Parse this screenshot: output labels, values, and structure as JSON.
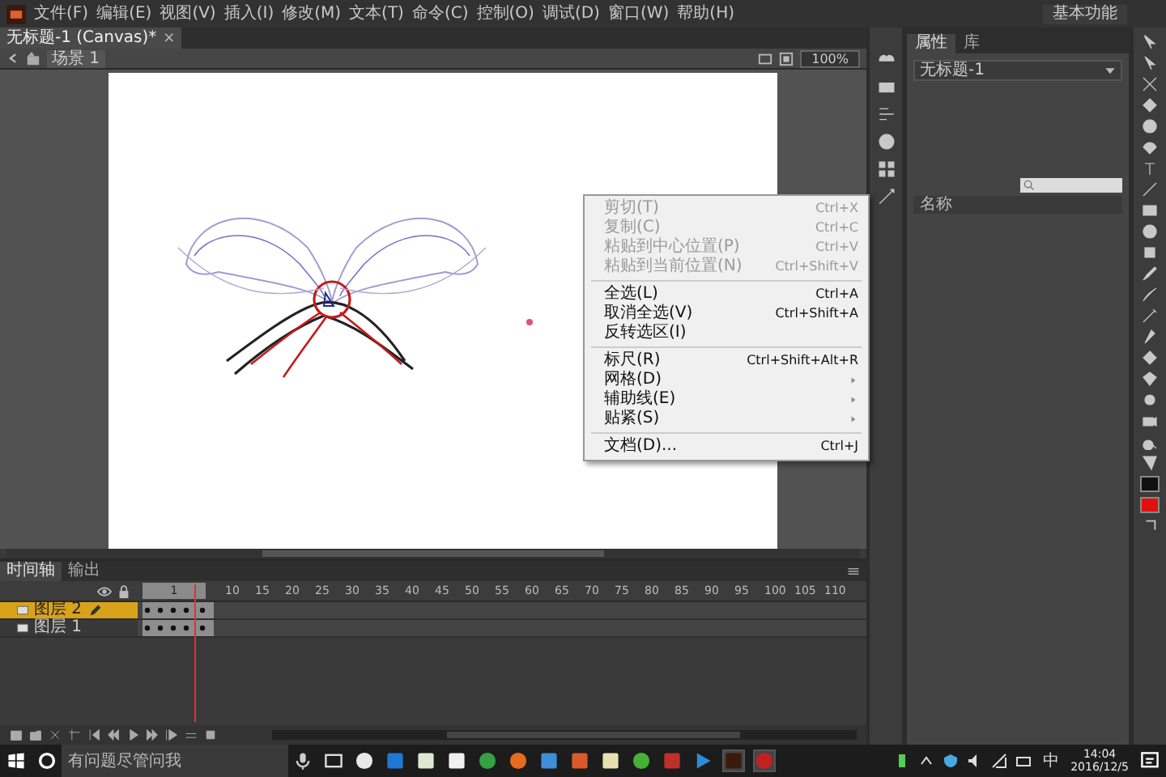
{
  "menu_bar": {
    "items": [
      "文件(F)",
      "编辑(E)",
      "视图(V)",
      "插入(I)",
      "修改(M)",
      "文本(T)",
      "命令(C)",
      "控制(O)",
      "调试(D)",
      "窗口(W)",
      "帮助(H)"
    ],
    "workspace": "基本功能"
  },
  "document_tab": {
    "title": "无标题-1 (Canvas)*",
    "close": "×"
  },
  "edit_bar": {
    "scene": "场景 1",
    "zoom": "100%"
  },
  "context_menu": {
    "groups": [
      [
        {
          "label": "剪切(T)",
          "shortcut": "Ctrl+X",
          "disabled": true,
          "submenu": false
        },
        {
          "label": "复制(C)",
          "shortcut": "Ctrl+C",
          "disabled": true,
          "submenu": false
        },
        {
          "label": "粘贴到中心位置(P)",
          "shortcut": "Ctrl+V",
          "disabled": true,
          "submenu": false
        },
        {
          "label": "粘贴到当前位置(N)",
          "shortcut": "Ctrl+Shift+V",
          "disabled": true,
          "submenu": false
        }
      ],
      [
        {
          "label": "全选(L)",
          "shortcut": "Ctrl+A",
          "disabled": false,
          "submenu": false
        },
        {
          "label": "取消全选(V)",
          "shortcut": "Ctrl+Shift+A",
          "disabled": false,
          "submenu": false
        },
        {
          "label": "反转选区(I)",
          "disabled": false,
          "submenu": false
        }
      ],
      [
        {
          "label": "标尺(R)",
          "shortcut": "Ctrl+Shift+Alt+R",
          "disabled": false,
          "submenu": false
        },
        {
          "label": "网格(D)",
          "disabled": false,
          "submenu": true
        },
        {
          "label": "辅助线(E)",
          "disabled": false,
          "submenu": true
        },
        {
          "label": "贴紧(S)",
          "disabled": false,
          "submenu": true
        }
      ],
      [
        {
          "label": "文档(D)...",
          "shortcut": "Ctrl+J",
          "disabled": false,
          "submenu": false
        }
      ]
    ]
  },
  "timeline": {
    "tabs": [
      {
        "label": "时间轴",
        "selected": true
      },
      {
        "label": "输出",
        "selected": false
      }
    ],
    "frame_span": "1",
    "ruler": [
      "10",
      "15",
      "20",
      "25",
      "30",
      "35",
      "40",
      "45",
      "50",
      "55",
      "60",
      "65",
      "70",
      "75",
      "80",
      "85",
      "90",
      "95",
      "100",
      "105",
      "110"
    ],
    "layers": [
      {
        "name": "图层 2",
        "selected": true
      },
      {
        "name": "图层 1",
        "selected": false
      }
    ]
  },
  "properties_panel": {
    "tabs": [
      {
        "label": "属性",
        "selected": true
      },
      {
        "label": "库",
        "selected": false
      }
    ],
    "document": "无标题-1",
    "column": "名称"
  },
  "taskbar": {
    "search_placeholder": "有问题尽管问我",
    "ime": "中",
    "time": "14:04",
    "date": "2016/12/5"
  }
}
